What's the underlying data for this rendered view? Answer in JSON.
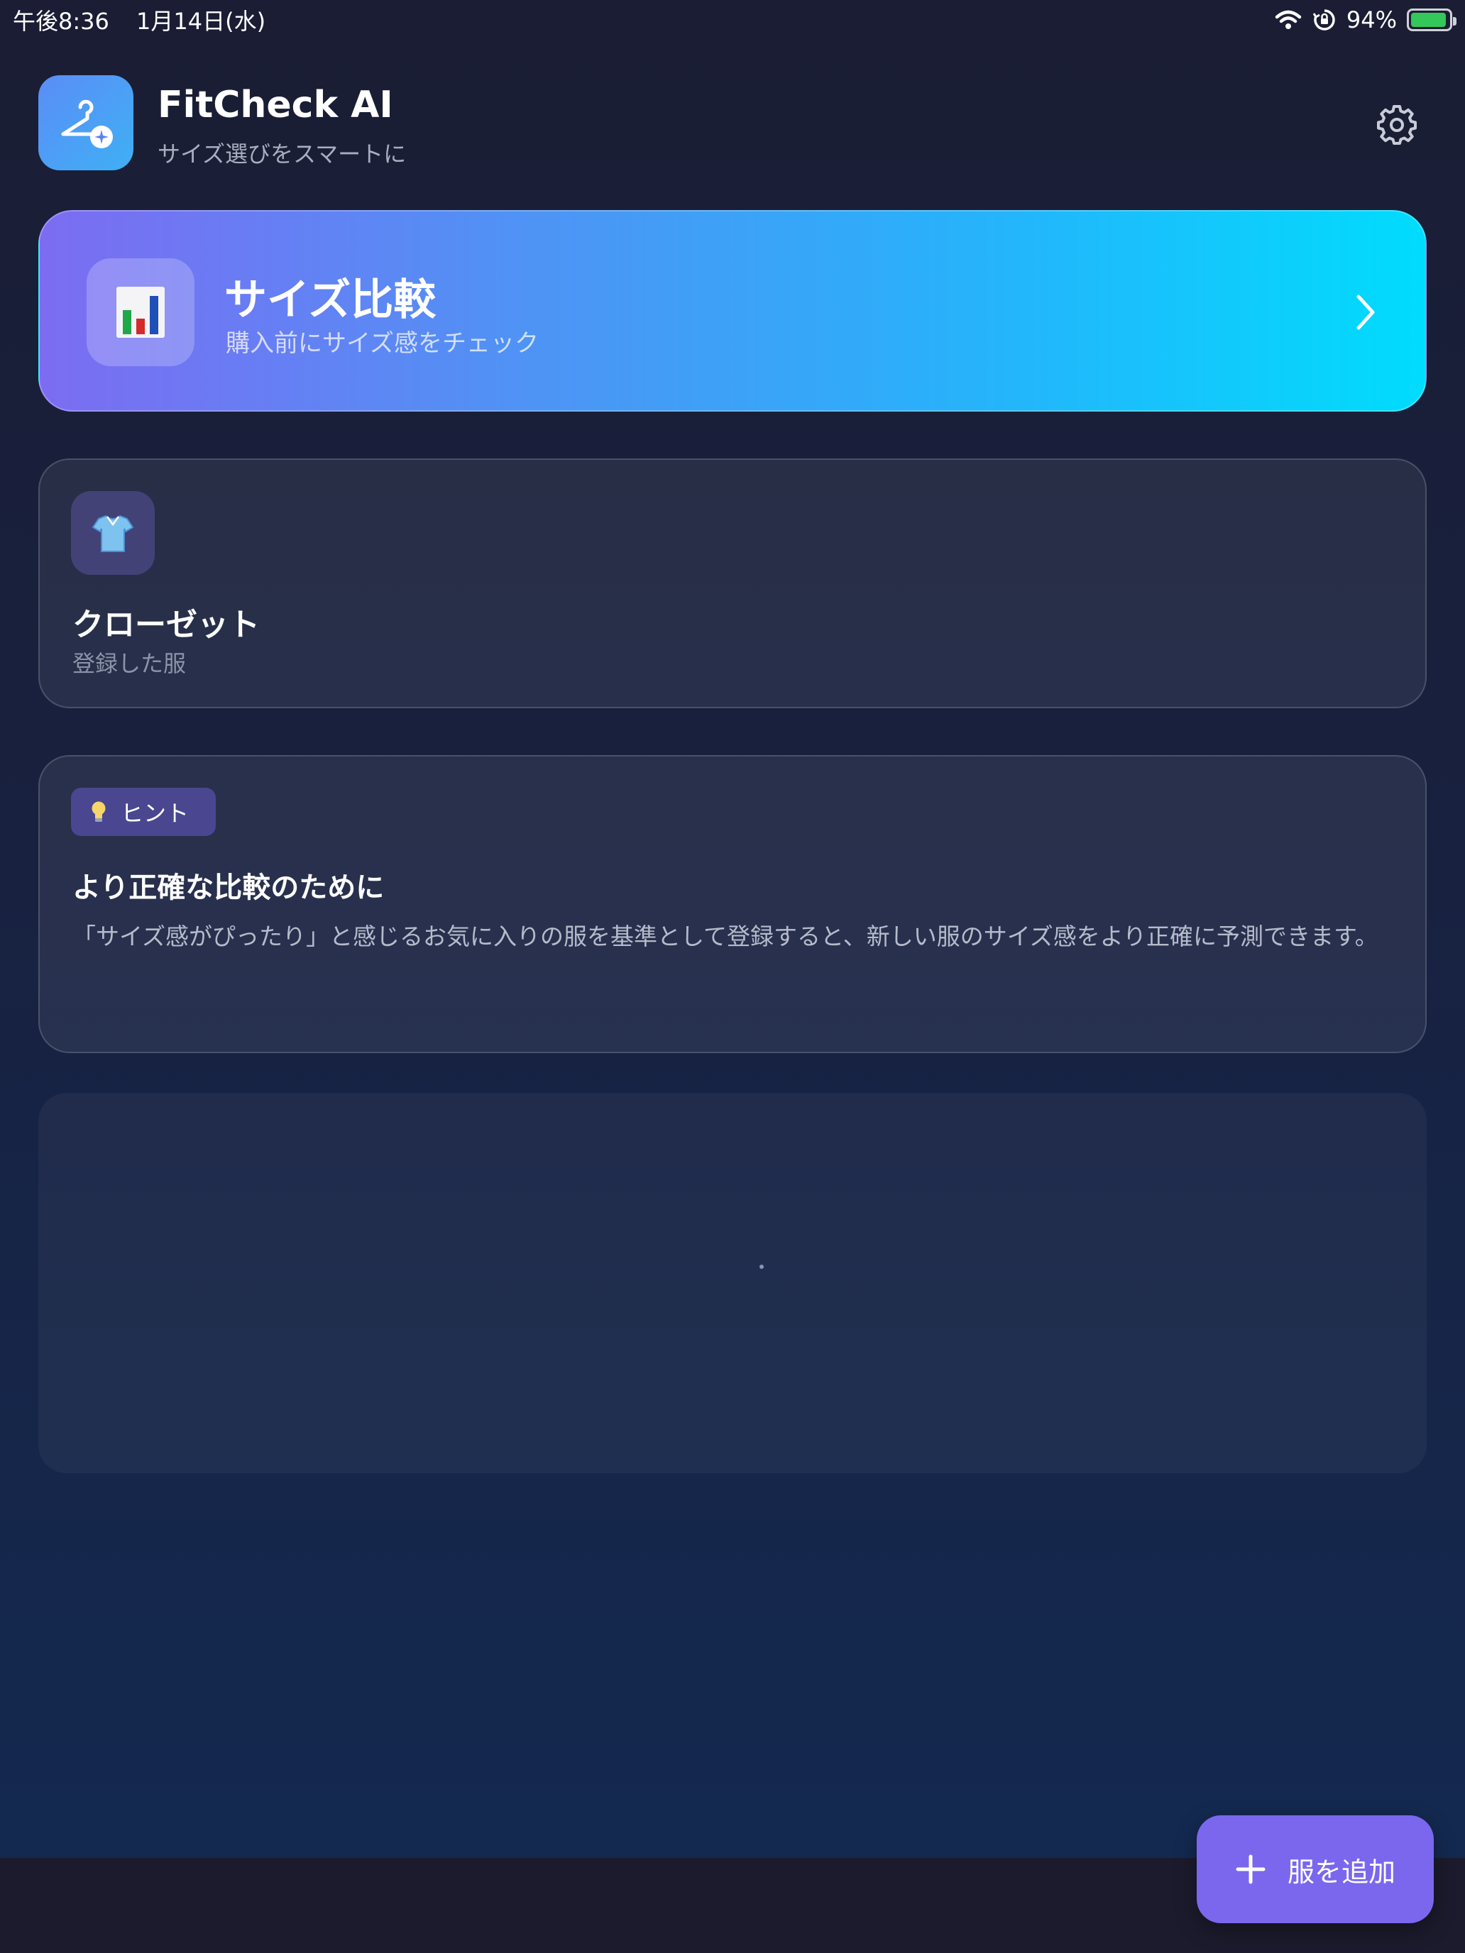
{
  "status_bar": {
    "time": "午後8:36",
    "date": "1月14日(水)",
    "battery_percent": "94%",
    "battery_level": 0.94,
    "battery_color": "#34c759"
  },
  "header": {
    "title": "FitCheck AI",
    "subtitle": "サイズ選びをスマートに",
    "logo_icon": "hanger-sparkle-icon",
    "settings_icon": "gear-icon"
  },
  "compare_card": {
    "title": "サイズ比較",
    "subtitle": "購入前にサイズ感をチェック",
    "icon": "bar-chart-icon",
    "gradient": [
      "#7c6cf2",
      "#00dcfd"
    ]
  },
  "closet_card": {
    "title": "クローゼット",
    "subtitle": "登録した服",
    "icon": "tshirt-icon"
  },
  "hint_card": {
    "badge_label": "ヒント",
    "badge_icon": "lightbulb-icon",
    "title": "より正確な比較のために",
    "body": "「サイズ感がぴったり」と感じるお気に入りの服を基準として登録すると、新しい服のサイズ感をより正確に予測できます。"
  },
  "fab": {
    "label": "服を追加",
    "icon": "plus-icon",
    "color": "#7a67ee"
  }
}
